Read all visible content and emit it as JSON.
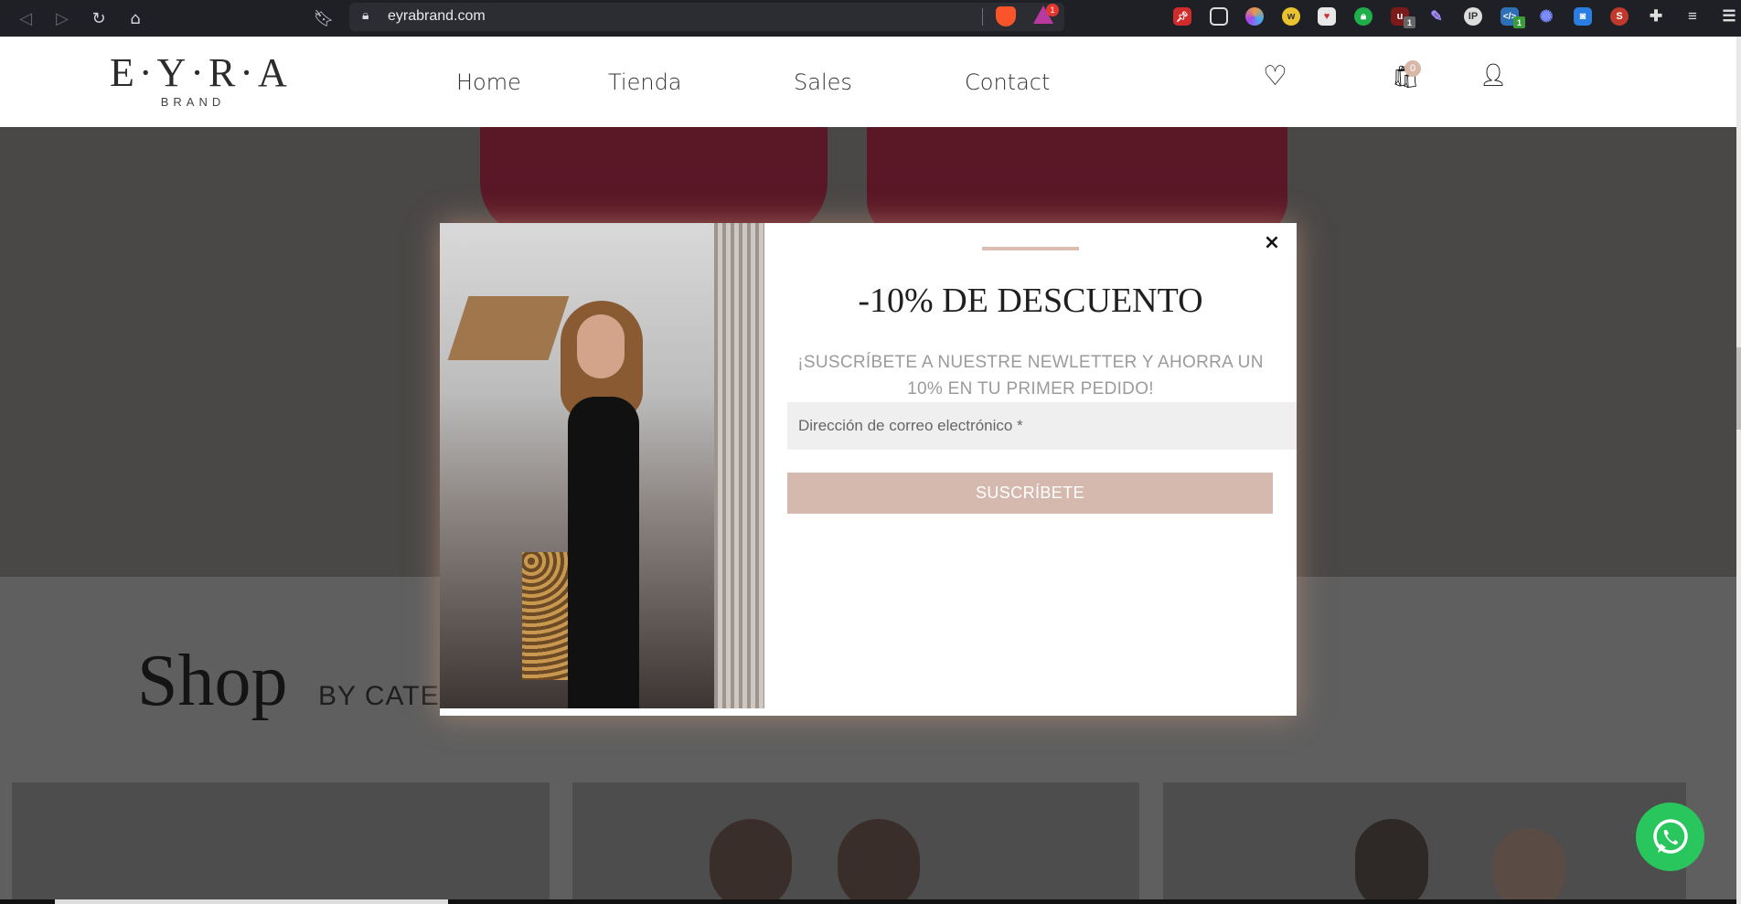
{
  "browser": {
    "url": "eyrabrand.com",
    "rewards_badge": "1",
    "extension_badges": [
      "1",
      "1"
    ]
  },
  "header": {
    "logo_main": "E·Y·R·A",
    "logo_sub": "BRAND",
    "nav": [
      "Home",
      "Tienda",
      "Sales",
      "Contact"
    ],
    "cart_count": "0"
  },
  "page": {
    "shop_title": "Shop",
    "shop_subtitle": "BY CATEG"
  },
  "modal": {
    "title": "-10% DE DESCUENTO",
    "subtitle": "¡SUSCRÍBETE A NUESTRE NEWLETTER Y AHORRA UN 10% EN TU PRIMER PEDIDO!",
    "email_placeholder": "Dirección de correo electrónico *",
    "button_label": "SUSCRÍBETE",
    "close_glyph": "×",
    "accent_color": "#d6b9ae"
  },
  "colors": {
    "whatsapp": "#29c55d",
    "cart_badge": "#d9b7a7"
  }
}
